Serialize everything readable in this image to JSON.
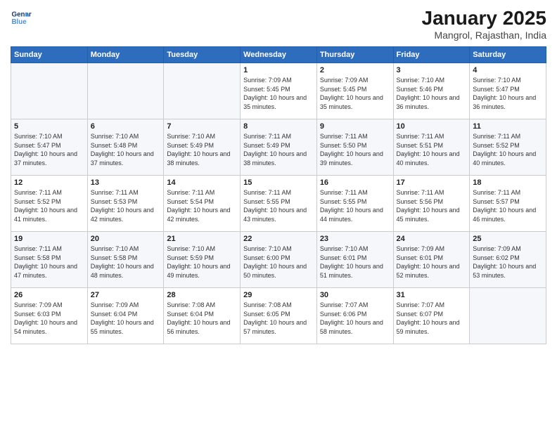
{
  "logo": {
    "line1": "General",
    "line2": "Blue"
  },
  "title": "January 2025",
  "subtitle": "Mangrol, Rajasthan, India",
  "weekdays": [
    "Sunday",
    "Monday",
    "Tuesday",
    "Wednesday",
    "Thursday",
    "Friday",
    "Saturday"
  ],
  "weeks": [
    [
      {
        "day": "",
        "sunrise": "",
        "sunset": "",
        "daylight": ""
      },
      {
        "day": "",
        "sunrise": "",
        "sunset": "",
        "daylight": ""
      },
      {
        "day": "",
        "sunrise": "",
        "sunset": "",
        "daylight": ""
      },
      {
        "day": "1",
        "sunrise": "Sunrise: 7:09 AM",
        "sunset": "Sunset: 5:45 PM",
        "daylight": "Daylight: 10 hours and 35 minutes."
      },
      {
        "day": "2",
        "sunrise": "Sunrise: 7:09 AM",
        "sunset": "Sunset: 5:45 PM",
        "daylight": "Daylight: 10 hours and 35 minutes."
      },
      {
        "day": "3",
        "sunrise": "Sunrise: 7:10 AM",
        "sunset": "Sunset: 5:46 PM",
        "daylight": "Daylight: 10 hours and 36 minutes."
      },
      {
        "day": "4",
        "sunrise": "Sunrise: 7:10 AM",
        "sunset": "Sunset: 5:47 PM",
        "daylight": "Daylight: 10 hours and 36 minutes."
      }
    ],
    [
      {
        "day": "5",
        "sunrise": "Sunrise: 7:10 AM",
        "sunset": "Sunset: 5:47 PM",
        "daylight": "Daylight: 10 hours and 37 minutes."
      },
      {
        "day": "6",
        "sunrise": "Sunrise: 7:10 AM",
        "sunset": "Sunset: 5:48 PM",
        "daylight": "Daylight: 10 hours and 37 minutes."
      },
      {
        "day": "7",
        "sunrise": "Sunrise: 7:10 AM",
        "sunset": "Sunset: 5:49 PM",
        "daylight": "Daylight: 10 hours and 38 minutes."
      },
      {
        "day": "8",
        "sunrise": "Sunrise: 7:11 AM",
        "sunset": "Sunset: 5:49 PM",
        "daylight": "Daylight: 10 hours and 38 minutes."
      },
      {
        "day": "9",
        "sunrise": "Sunrise: 7:11 AM",
        "sunset": "Sunset: 5:50 PM",
        "daylight": "Daylight: 10 hours and 39 minutes."
      },
      {
        "day": "10",
        "sunrise": "Sunrise: 7:11 AM",
        "sunset": "Sunset: 5:51 PM",
        "daylight": "Daylight: 10 hours and 40 minutes."
      },
      {
        "day": "11",
        "sunrise": "Sunrise: 7:11 AM",
        "sunset": "Sunset: 5:52 PM",
        "daylight": "Daylight: 10 hours and 40 minutes."
      }
    ],
    [
      {
        "day": "12",
        "sunrise": "Sunrise: 7:11 AM",
        "sunset": "Sunset: 5:52 PM",
        "daylight": "Daylight: 10 hours and 41 minutes."
      },
      {
        "day": "13",
        "sunrise": "Sunrise: 7:11 AM",
        "sunset": "Sunset: 5:53 PM",
        "daylight": "Daylight: 10 hours and 42 minutes."
      },
      {
        "day": "14",
        "sunrise": "Sunrise: 7:11 AM",
        "sunset": "Sunset: 5:54 PM",
        "daylight": "Daylight: 10 hours and 42 minutes."
      },
      {
        "day": "15",
        "sunrise": "Sunrise: 7:11 AM",
        "sunset": "Sunset: 5:55 PM",
        "daylight": "Daylight: 10 hours and 43 minutes."
      },
      {
        "day": "16",
        "sunrise": "Sunrise: 7:11 AM",
        "sunset": "Sunset: 5:55 PM",
        "daylight": "Daylight: 10 hours and 44 minutes."
      },
      {
        "day": "17",
        "sunrise": "Sunrise: 7:11 AM",
        "sunset": "Sunset: 5:56 PM",
        "daylight": "Daylight: 10 hours and 45 minutes."
      },
      {
        "day": "18",
        "sunrise": "Sunrise: 7:11 AM",
        "sunset": "Sunset: 5:57 PM",
        "daylight": "Daylight: 10 hours and 46 minutes."
      }
    ],
    [
      {
        "day": "19",
        "sunrise": "Sunrise: 7:11 AM",
        "sunset": "Sunset: 5:58 PM",
        "daylight": "Daylight: 10 hours and 47 minutes."
      },
      {
        "day": "20",
        "sunrise": "Sunrise: 7:10 AM",
        "sunset": "Sunset: 5:58 PM",
        "daylight": "Daylight: 10 hours and 48 minutes."
      },
      {
        "day": "21",
        "sunrise": "Sunrise: 7:10 AM",
        "sunset": "Sunset: 5:59 PM",
        "daylight": "Daylight: 10 hours and 49 minutes."
      },
      {
        "day": "22",
        "sunrise": "Sunrise: 7:10 AM",
        "sunset": "Sunset: 6:00 PM",
        "daylight": "Daylight: 10 hours and 50 minutes."
      },
      {
        "day": "23",
        "sunrise": "Sunrise: 7:10 AM",
        "sunset": "Sunset: 6:01 PM",
        "daylight": "Daylight: 10 hours and 51 minutes."
      },
      {
        "day": "24",
        "sunrise": "Sunrise: 7:09 AM",
        "sunset": "Sunset: 6:01 PM",
        "daylight": "Daylight: 10 hours and 52 minutes."
      },
      {
        "day": "25",
        "sunrise": "Sunrise: 7:09 AM",
        "sunset": "Sunset: 6:02 PM",
        "daylight": "Daylight: 10 hours and 53 minutes."
      }
    ],
    [
      {
        "day": "26",
        "sunrise": "Sunrise: 7:09 AM",
        "sunset": "Sunset: 6:03 PM",
        "daylight": "Daylight: 10 hours and 54 minutes."
      },
      {
        "day": "27",
        "sunrise": "Sunrise: 7:09 AM",
        "sunset": "Sunset: 6:04 PM",
        "daylight": "Daylight: 10 hours and 55 minutes."
      },
      {
        "day": "28",
        "sunrise": "Sunrise: 7:08 AM",
        "sunset": "Sunset: 6:04 PM",
        "daylight": "Daylight: 10 hours and 56 minutes."
      },
      {
        "day": "29",
        "sunrise": "Sunrise: 7:08 AM",
        "sunset": "Sunset: 6:05 PM",
        "daylight": "Daylight: 10 hours and 57 minutes."
      },
      {
        "day": "30",
        "sunrise": "Sunrise: 7:07 AM",
        "sunset": "Sunset: 6:06 PM",
        "daylight": "Daylight: 10 hours and 58 minutes."
      },
      {
        "day": "31",
        "sunrise": "Sunrise: 7:07 AM",
        "sunset": "Sunset: 6:07 PM",
        "daylight": "Daylight: 10 hours and 59 minutes."
      },
      {
        "day": "",
        "sunrise": "",
        "sunset": "",
        "daylight": ""
      }
    ]
  ]
}
